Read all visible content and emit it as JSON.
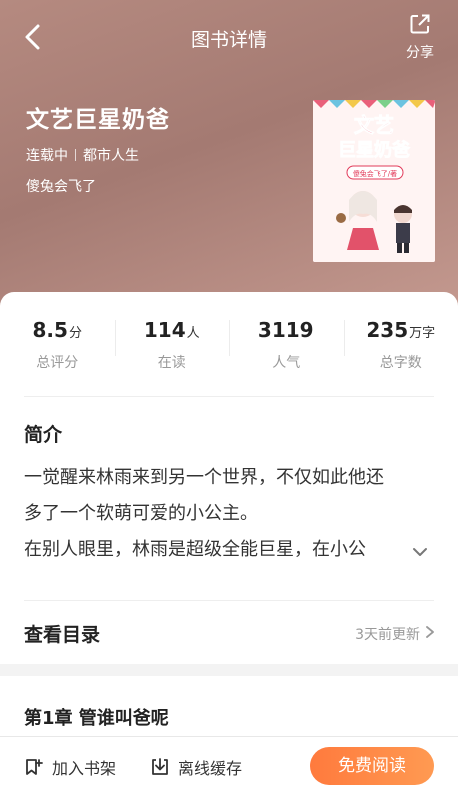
{
  "header": {
    "title": "图书详情",
    "share_label": "分享"
  },
  "book": {
    "title": "文艺巨星奶爸",
    "status": "连载中",
    "category": "都市人生",
    "author": "傻兔会飞了",
    "cover": {
      "title_lines": [
        "文艺",
        "巨星奶爸"
      ],
      "author_tag": "傻兔会飞了/著"
    }
  },
  "stats": [
    {
      "value": "8.5",
      "unit": "分",
      "label": "总评分"
    },
    {
      "value": "114",
      "unit": "人",
      "label": "在读"
    },
    {
      "value": "3119",
      "unit": "",
      "label": "人气"
    },
    {
      "value": "235",
      "unit": "万字",
      "label": "总字数"
    }
  ],
  "intro": {
    "heading": "简介",
    "lines": [
      "一觉醒来林雨来到另一个世界，不仅如此他还",
      "多了一个软萌可爱的小公主。",
      "在别人眼里，林雨是超级全能巨星，在小公"
    ]
  },
  "toc": {
    "heading": "查看目录",
    "update": "3天前更新"
  },
  "chapter": {
    "title": "第1章 管谁叫爸呢"
  },
  "bottom": {
    "shelf": "加入书架",
    "offline": "离线缓存",
    "read": "免费阅读"
  },
  "colors": {
    "accent": "#ff8a45",
    "hero": "#b0857b"
  }
}
